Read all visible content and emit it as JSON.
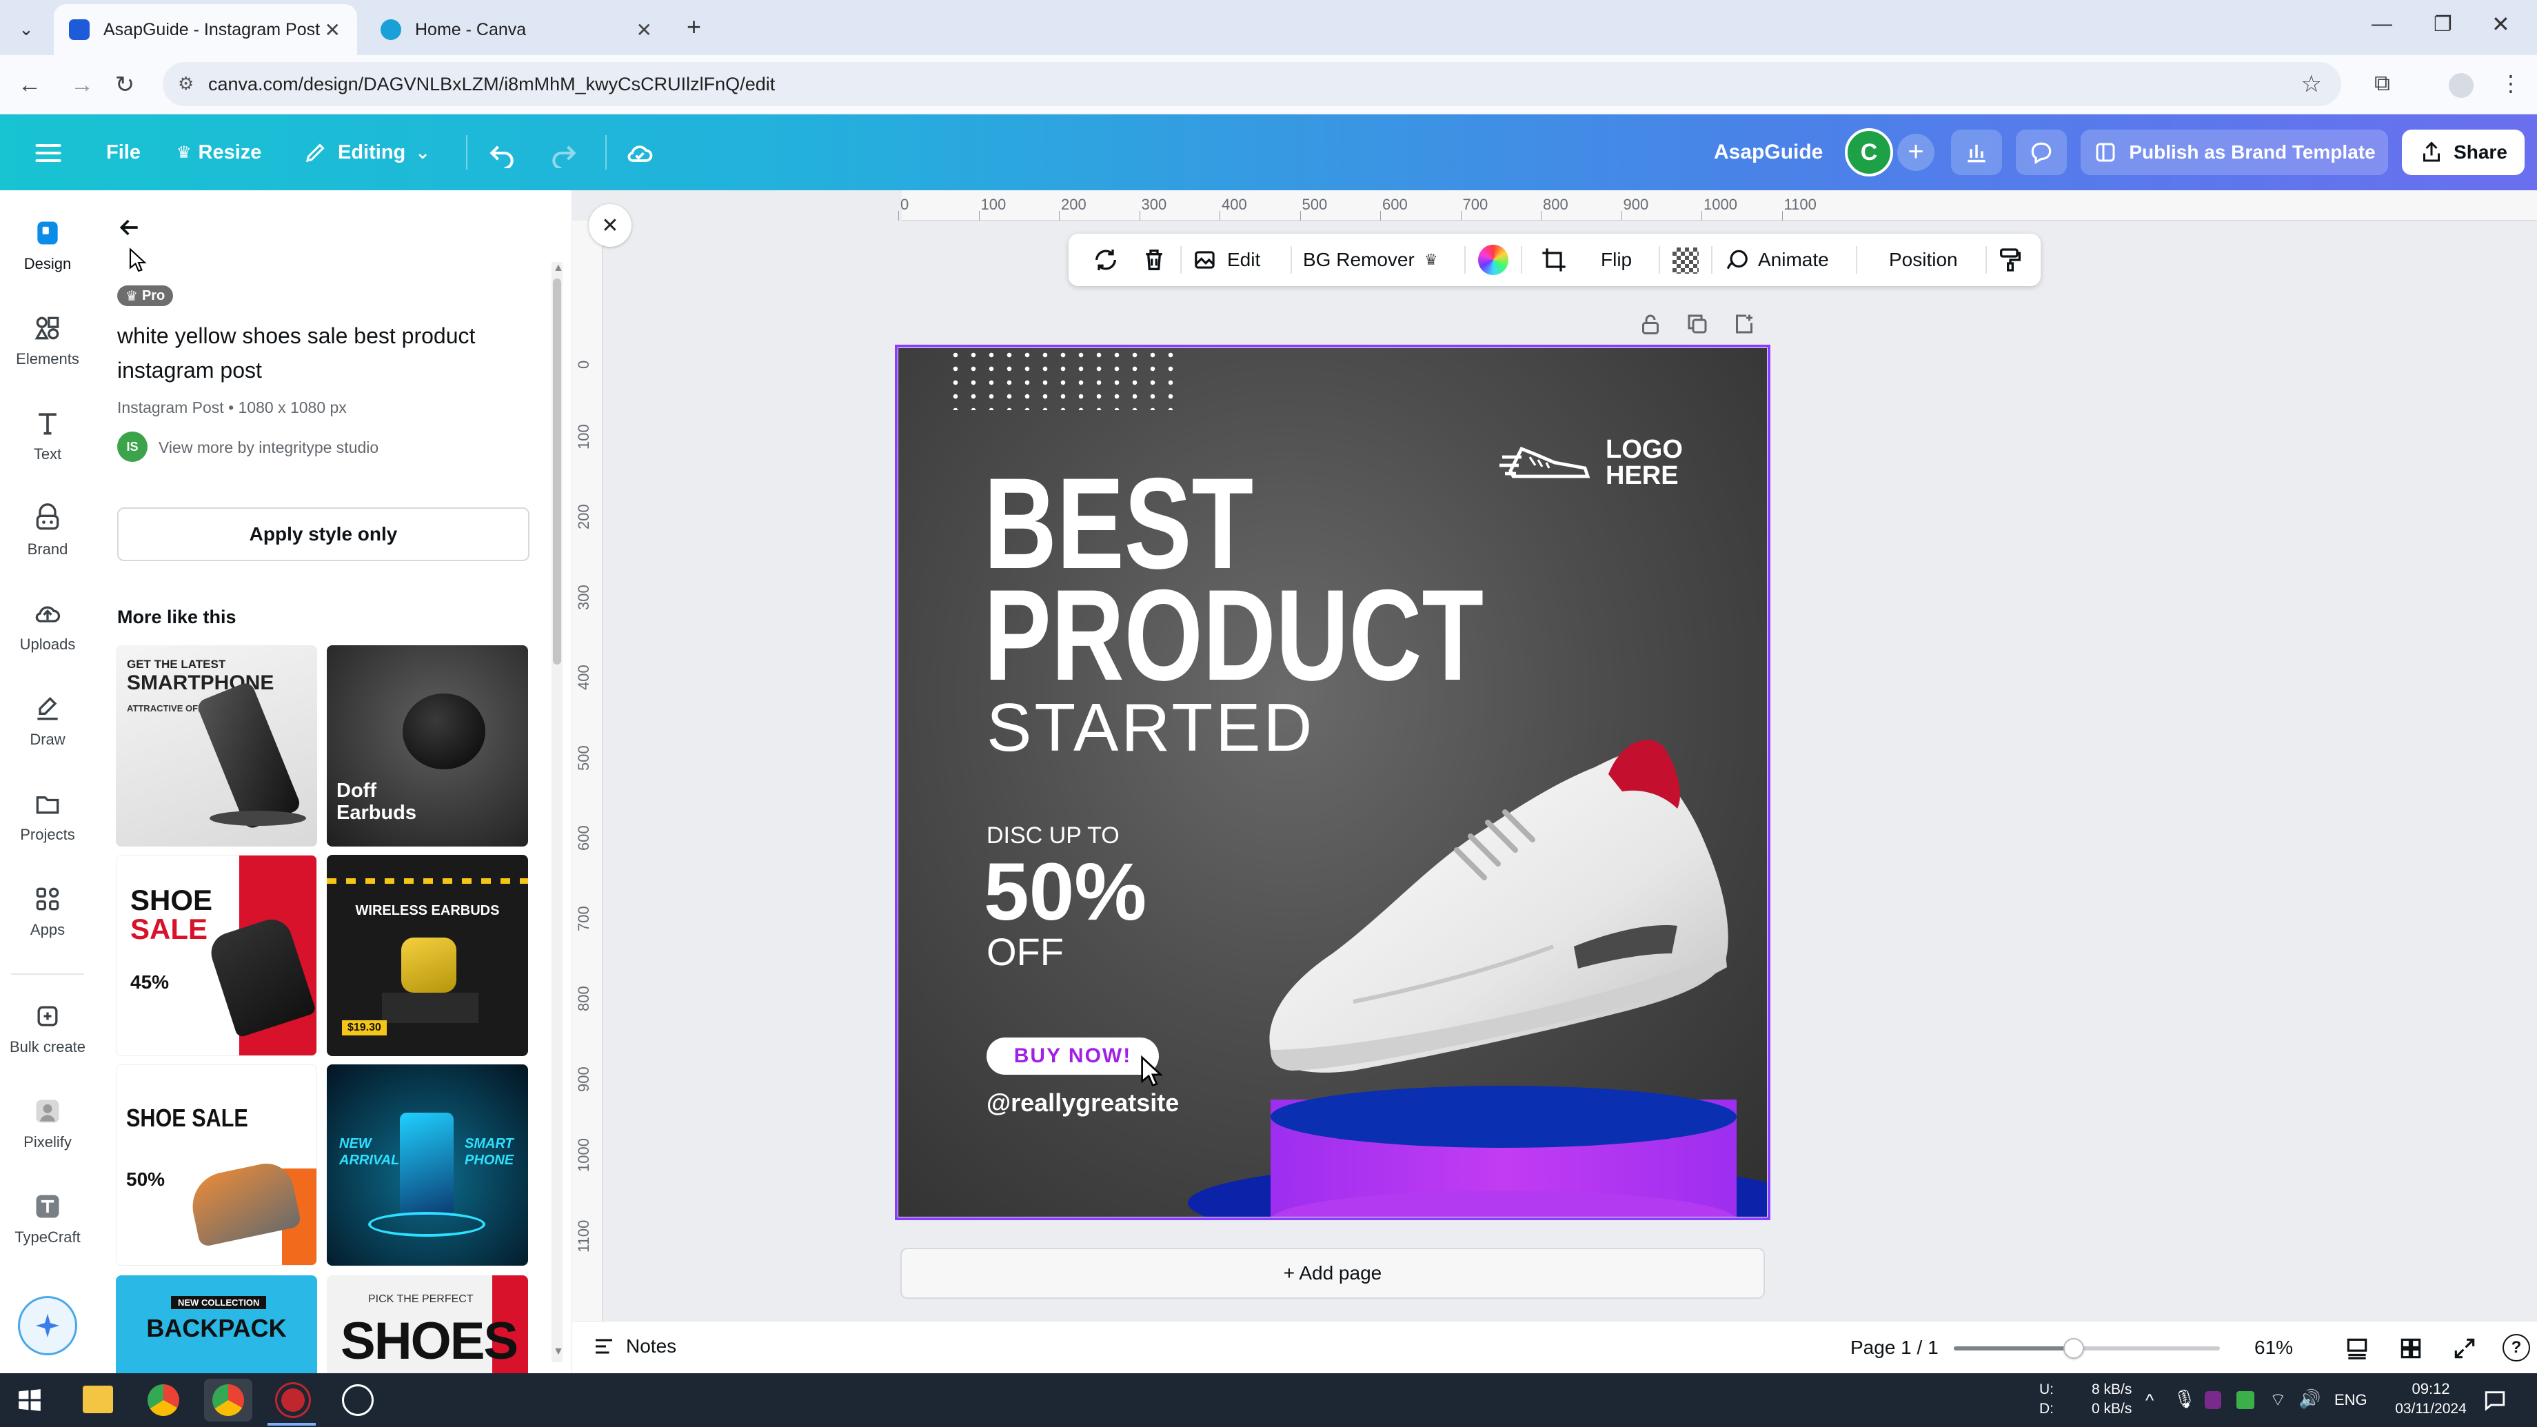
{
  "browser": {
    "tabs": [
      {
        "title": "AsapGuide - Instagram Post",
        "active": true
      },
      {
        "title": "Home - Canva",
        "active": false
      }
    ],
    "url": "canva.com/design/DAGVNLBxLZM/i8mMhM_kwyCsCRUIlzlFnQ/edit"
  },
  "header": {
    "file": "File",
    "resize": "Resize",
    "editing": "Editing",
    "team": "AsapGuide",
    "avatar_letter": "C",
    "publish": "Publish as Brand Template",
    "share": "Share"
  },
  "rail": {
    "items": [
      {
        "label": "Design",
        "icon": "design-icon"
      },
      {
        "label": "Elements",
        "icon": "elements-icon"
      },
      {
        "label": "Text",
        "icon": "text-icon"
      },
      {
        "label": "Brand",
        "icon": "brand-icon"
      },
      {
        "label": "Uploads",
        "icon": "uploads-icon"
      },
      {
        "label": "Draw",
        "icon": "draw-icon"
      },
      {
        "label": "Projects",
        "icon": "projects-icon"
      },
      {
        "label": "Apps",
        "icon": "apps-icon"
      },
      {
        "label": "Bulk create",
        "icon": "bulk-create-icon"
      },
      {
        "label": "Pixelify",
        "icon": "pixelify-icon"
      },
      {
        "label": "TypeCraft",
        "icon": "typecraft-icon"
      }
    ]
  },
  "panel": {
    "badge": "Pro",
    "title": "white yellow shoes sale best product instagram post",
    "meta": "Instagram Post • 1080 x 1080 px",
    "author_initials": "IS",
    "author": "View more by integritype studio",
    "apply_btn": "Apply style only",
    "section": "More like this",
    "thumbs": [
      {
        "lines": [
          "GET THE LATEST",
          "SMARTPHONE",
          "ATTRACTIVE OFFER!"
        ],
        "bg": "#ededed"
      },
      {
        "lines": [
          "Doff",
          "Earbuds"
        ],
        "bg": "#2a2a2a"
      },
      {
        "lines": [
          "SHOE",
          "SALE",
          "45%"
        ],
        "bg": "#ffffff"
      },
      {
        "lines": [
          "WIRELESS EARBUDS",
          "$19.30"
        ],
        "bg": "#1e1e1e"
      },
      {
        "lines": [
          "SHOE SALE",
          "50%"
        ],
        "bg": "#ffffff"
      },
      {
        "lines": [
          "NEW",
          "ARRIVAL",
          "SMART",
          "PHONE"
        ],
        "bg": "#041a2c"
      },
      {
        "lines": [
          "NEW COLLECTION",
          "BACKPACK"
        ],
        "bg": "#2ab8e6"
      },
      {
        "lines": [
          "PICK THE PERFECT",
          "SHOES"
        ],
        "bg": "#f2f2f2"
      }
    ]
  },
  "ruler": {
    "top": [
      "0",
      "100",
      "200",
      "300",
      "400",
      "500",
      "600",
      "700",
      "800",
      "900",
      "1000",
      "1100"
    ],
    "left": [
      "0",
      "100",
      "200",
      "300",
      "400",
      "500",
      "600",
      "700",
      "800",
      "900",
      "1000",
      "1100"
    ]
  },
  "toolbar": {
    "edit": "Edit",
    "bg_remover": "BG Remover",
    "flip": "Flip",
    "animate": "Animate",
    "position": "Position"
  },
  "design": {
    "logo_line1": "LOGO",
    "logo_line2": "HERE",
    "headline1": "BEST",
    "headline2": "PRODUCT",
    "headline3": "STARTED",
    "disc": "DISC UP TO",
    "percent": "50%",
    "off": "OFF",
    "cta": "BUY NOW!",
    "site": "@reallygreatsite",
    "colors": {
      "podium_top": "#0a2fb0",
      "podium_side": "#b23cf0",
      "cta_text": "#a020e8"
    }
  },
  "workspace": {
    "add_page": "+ Add page",
    "notes": "Notes",
    "page": "Page 1 / 1",
    "zoom": "61%",
    "zoom_level": 0.45
  },
  "taskbar": {
    "net_up": "8 kB/s",
    "net_down": "0 kB/s",
    "net_u": "U:",
    "net_d": "D:",
    "lang": "ENG",
    "time": "09:12",
    "date": "03/11/2024"
  }
}
